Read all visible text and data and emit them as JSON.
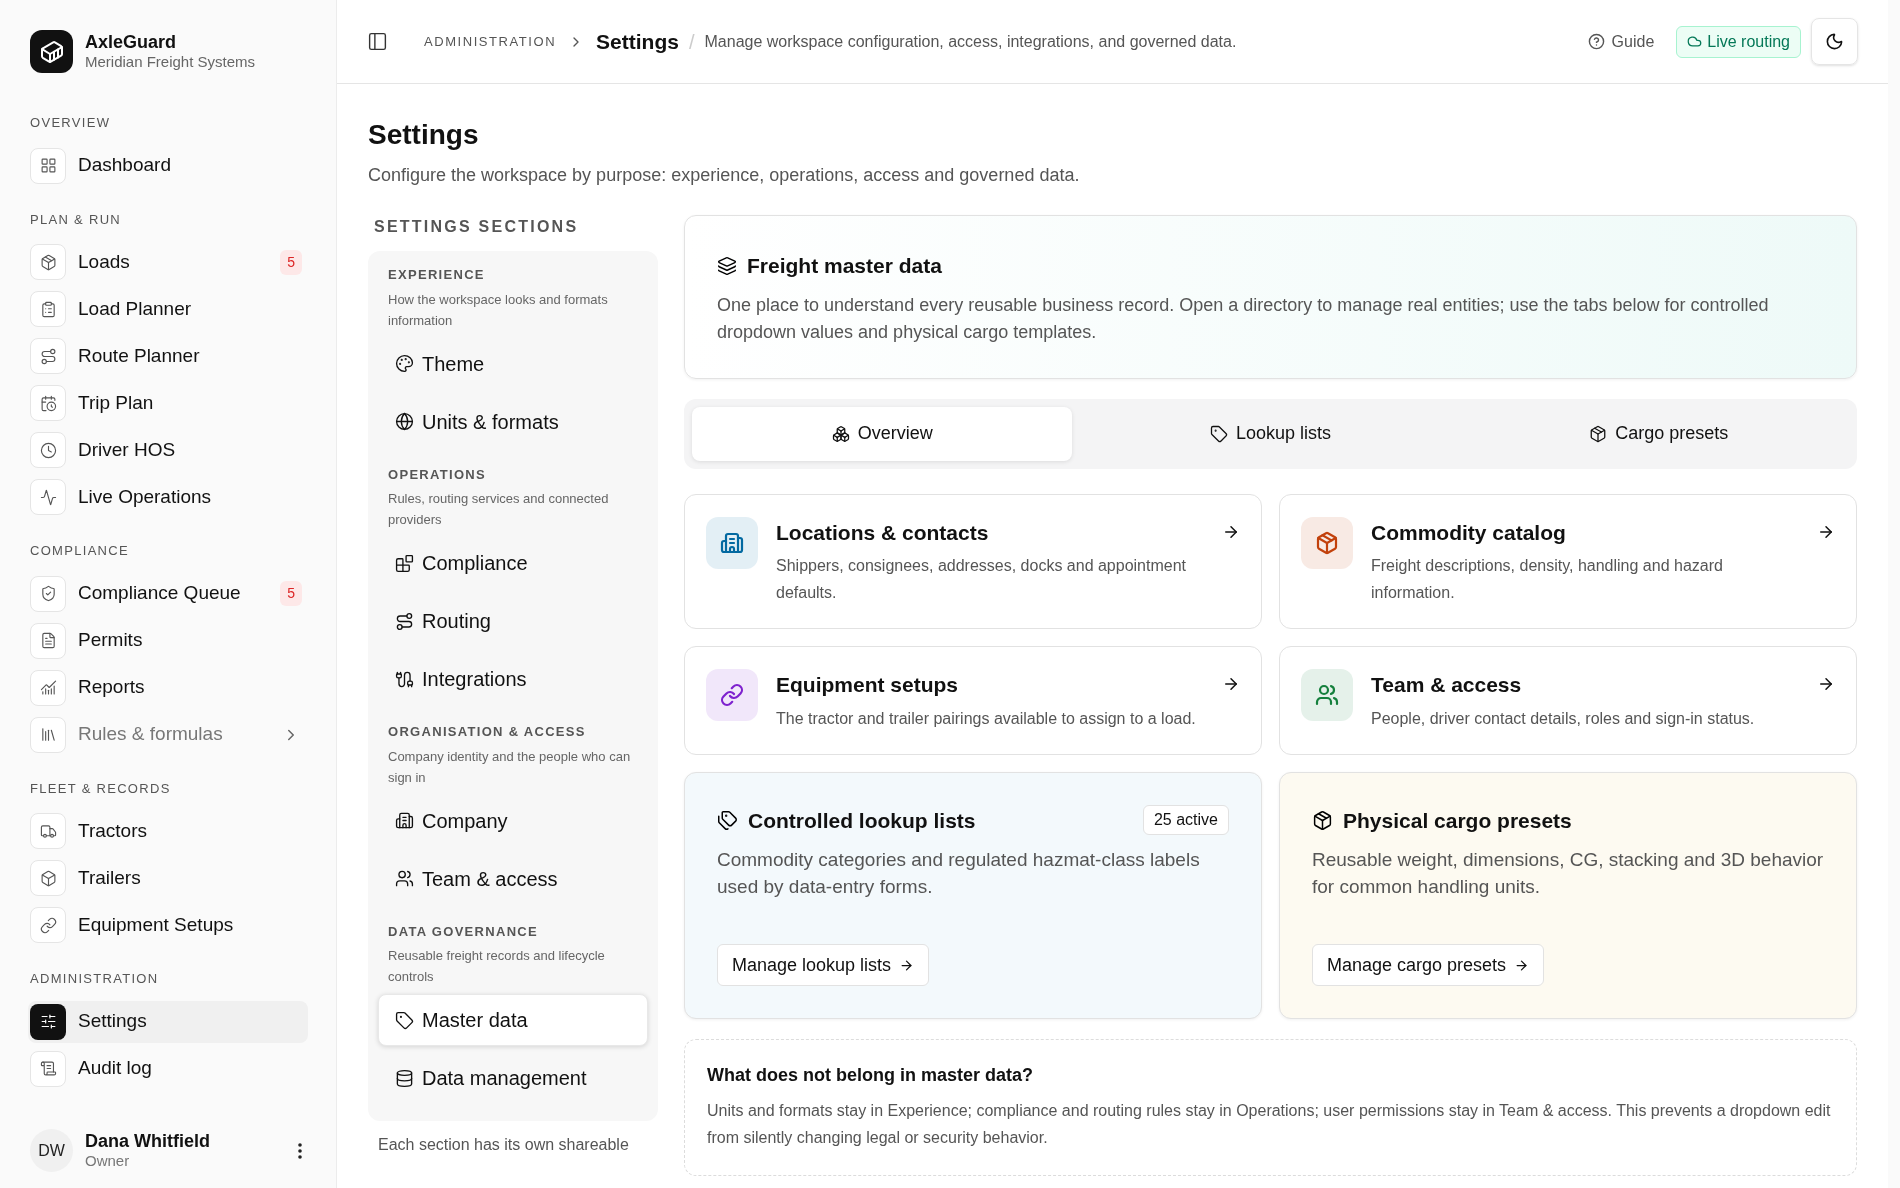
{
  "brand": {
    "name": "AxleGuard",
    "subtitle": "Meridian Freight Systems"
  },
  "sidebar": {
    "sections": [
      {
        "title": "OVERVIEW",
        "items": [
          {
            "label": "Dashboard",
            "selected": false,
            "disabled": false
          }
        ]
      },
      {
        "title": "PLAN & RUN",
        "items": [
          {
            "label": "Loads",
            "selected": false,
            "disabled": false,
            "badge": "5"
          },
          {
            "label": "Load Planner",
            "selected": false,
            "disabled": false
          },
          {
            "label": "Route Planner",
            "selected": false,
            "disabled": false
          },
          {
            "label": "Trip Plan",
            "selected": false,
            "disabled": false
          },
          {
            "label": "Driver HOS",
            "selected": false,
            "disabled": false
          },
          {
            "label": "Live Operations",
            "selected": false,
            "disabled": false
          }
        ]
      },
      {
        "title": "COMPLIANCE",
        "items": [
          {
            "label": "Compliance Queue",
            "selected": false,
            "disabled": false,
            "badge": "5"
          },
          {
            "label": "Permits",
            "selected": false,
            "disabled": false
          },
          {
            "label": "Reports",
            "selected": false,
            "disabled": false
          },
          {
            "label": "Rules & formulas",
            "selected": false,
            "disabled": true,
            "expandable": true
          }
        ]
      },
      {
        "title": "FLEET & RECORDS",
        "items": [
          {
            "label": "Tractors",
            "selected": false,
            "disabled": false
          },
          {
            "label": "Trailers",
            "selected": false,
            "disabled": false
          },
          {
            "label": "Equipment Setups",
            "selected": false,
            "disabled": false
          }
        ]
      },
      {
        "title": "ADMINISTRATION",
        "items": [
          {
            "label": "Settings",
            "selected": true,
            "disabled": false
          },
          {
            "label": "Audit log",
            "selected": false,
            "disabled": false
          }
        ]
      }
    ],
    "user": {
      "initials": "DW",
      "name": "Dana Whitfield",
      "role": "Owner"
    }
  },
  "topbar": {
    "breadcrumb": "ADMINISTRATION",
    "title": "Settings",
    "description": "Manage workspace configuration, access, integrations, and governed data.",
    "separator": "/",
    "guide": "Guide",
    "status": "Live routing"
  },
  "page": {
    "title": "Settings",
    "subtitle": "Configure the workspace by purpose: experience, operations, access and governed data."
  },
  "settings_nav": {
    "heading": "SETTINGS SECTIONS",
    "groups": [
      {
        "title": "EXPERIENCE",
        "description": "How the workspace looks and formats information",
        "items": [
          {
            "label": "Theme",
            "selected": false
          },
          {
            "label": "Units & formats",
            "selected": false
          }
        ]
      },
      {
        "title": "OPERATIONS",
        "description": "Rules, routing services and connected providers",
        "items": [
          {
            "label": "Compliance",
            "selected": false
          },
          {
            "label": "Routing",
            "selected": false
          },
          {
            "label": "Integrations",
            "selected": false
          }
        ]
      },
      {
        "title": "ORGANISATION & ACCESS",
        "description": "Company identity and the people who can sign in",
        "items": [
          {
            "label": "Company",
            "selected": false
          },
          {
            "label": "Team & access",
            "selected": false
          }
        ]
      },
      {
        "title": "DATA GOVERNANCE",
        "description": "Reusable freight records and lifecycle controls",
        "items": [
          {
            "label": "Master data",
            "selected": true
          },
          {
            "label": "Data management",
            "selected": false
          }
        ]
      }
    ],
    "footer": "Each section has its own shareable"
  },
  "hero": {
    "title": "Freight master data",
    "description": "One place to understand every reusable business record. Open a directory to manage real entities; use the tabs below for controlled dropdown values and physical cargo templates."
  },
  "tabs": [
    {
      "label": "Overview",
      "selected": true
    },
    {
      "label": "Lookup lists",
      "selected": false
    },
    {
      "label": "Cargo presets",
      "selected": false
    }
  ],
  "directories": [
    {
      "title": "Locations & contacts",
      "description": "Shippers, consignees, addresses, docks and appointment defaults.",
      "color": "#0369a1"
    },
    {
      "title": "Commodity catalog",
      "description": "Freight descriptions, density, handling and hazard information.",
      "color": "#c2410c"
    },
    {
      "title": "Equipment setups",
      "description": "The tractor and trailer pairings available to assign to a load.",
      "color": "#7e22ce"
    },
    {
      "title": "Team & access",
      "description": "People, driver contact details, roles and sign-in status.",
      "color": "#15803d"
    }
  ],
  "features": [
    {
      "kind": "lookup",
      "title": "Controlled lookup lists",
      "badge": "25 active",
      "description": "Commodity categories and regulated hazmat-class labels used by data-entry forms.",
      "action": "Manage lookup lists"
    },
    {
      "kind": "cargo",
      "title": "Physical cargo presets",
      "description": "Reusable weight, dimensions, CG, stacking and 3D behavior for common handling units.",
      "action": "Manage cargo presets"
    }
  ],
  "note": {
    "title": "What does not belong in master data?",
    "text": "Units and formats stay in Experience; compliance and routing rules stay in Operations; user permissions stay in Team & access. This prevents a dropdown edit from silently changing legal or security behavior."
  }
}
